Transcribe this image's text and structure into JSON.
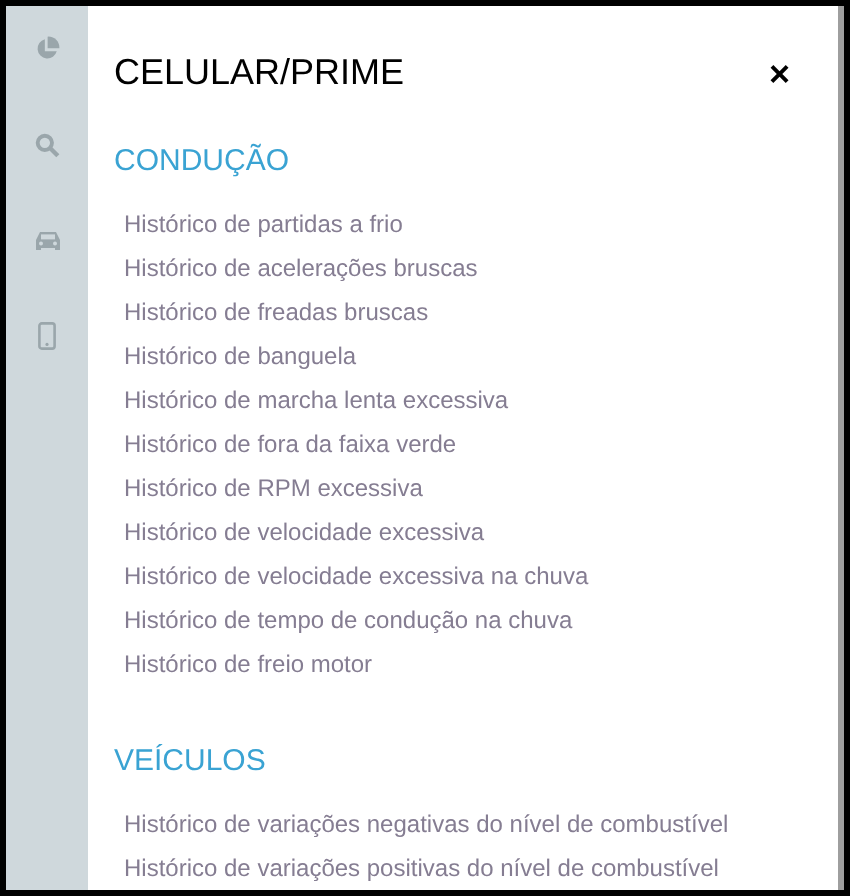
{
  "sidebar": {
    "items": [
      {
        "kind": "chart"
      },
      {
        "kind": "search"
      },
      {
        "kind": "car"
      },
      {
        "kind": "phone"
      }
    ]
  },
  "panel": {
    "title": "CELULAR/PRIME",
    "close": "×"
  },
  "sections": [
    {
      "heading": "CONDUÇÃO",
      "links": [
        "Histórico de partidas a frio",
        "Histórico de acelerações bruscas",
        "Histórico de freadas bruscas",
        "Histórico de banguela",
        "Histórico de marcha lenta excessiva",
        "Histórico de fora da faixa verde",
        "Histórico de RPM excessiva",
        "Histórico de velocidade excessiva",
        "Histórico de velocidade excessiva na chuva",
        "Histórico de tempo de condução na chuva",
        "Histórico de freio motor"
      ]
    },
    {
      "heading": "VEÍCULOS",
      "links": [
        "Histórico de variações negativas do nível de combustível",
        "Histórico de variações positivas do nível de combustível"
      ]
    }
  ]
}
